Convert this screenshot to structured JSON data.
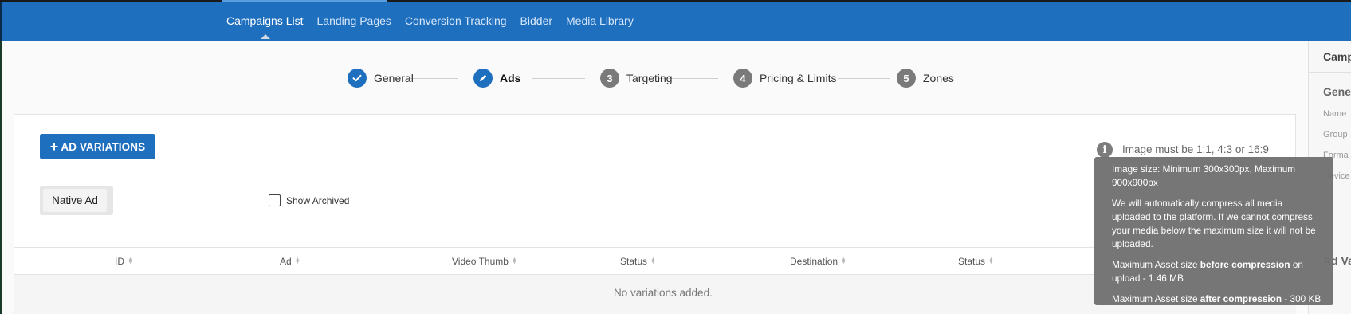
{
  "nav": {
    "items": [
      "Campaigns List",
      "Landing Pages",
      "Conversion Tracking",
      "Bidder",
      "Media Library"
    ],
    "active_index": 0
  },
  "stepper": {
    "steps": [
      {
        "label": "General",
        "badge": "check",
        "state": "done"
      },
      {
        "label": "Ads",
        "badge": "pencil",
        "state": "current"
      },
      {
        "label": "Targeting",
        "badge": "3",
        "state": "pending"
      },
      {
        "label": "Pricing & Limits",
        "badge": "4",
        "state": "pending"
      },
      {
        "label": "Zones",
        "badge": "5",
        "state": "pending"
      }
    ]
  },
  "toolbar": {
    "add_plus": "+",
    "add_label": "AD VARIATIONS",
    "info_glyph": "i",
    "info_text": "Image must be 1:1, 4:3 or 16:9"
  },
  "tabs": {
    "items": [
      "Native Ad"
    ]
  },
  "archived": {
    "label": "Show Archived",
    "checked": false
  },
  "table": {
    "columns": [
      "ID",
      "Ad",
      "Video Thumb",
      "Status",
      "Destination",
      "Status"
    ],
    "empty_text": "No variations added."
  },
  "sidebar": {
    "title": "Camp",
    "heading": "Gene",
    "fields": [
      "Name",
      "Group",
      "Forma",
      "Device"
    ],
    "heading2": "Ad Va"
  },
  "tooltip": {
    "p1": "Image size: Minimum 300x300px, Maximum 900x900px",
    "p2": "We will automatically compress all media uploaded to the platform. If we cannot compress your media below the maximum size it will not be uploaded.",
    "p3_a": "Maximum Asset size ",
    "p3_b": "before compression",
    "p3_c": " on upload - 1.46 MB",
    "p4_a": "Maximum Asset size ",
    "p4_b": "after compression",
    "p4_c": " - 300 KB"
  },
  "colors": {
    "primary": "#1f6fbf",
    "step_pending": "#7a7a7a",
    "tooltip_bg": "#707070"
  },
  "icons": [
    "check-icon",
    "pencil-icon",
    "info-icon",
    "sort-icon",
    "checkbox-icon",
    "caret-up-icon"
  ]
}
